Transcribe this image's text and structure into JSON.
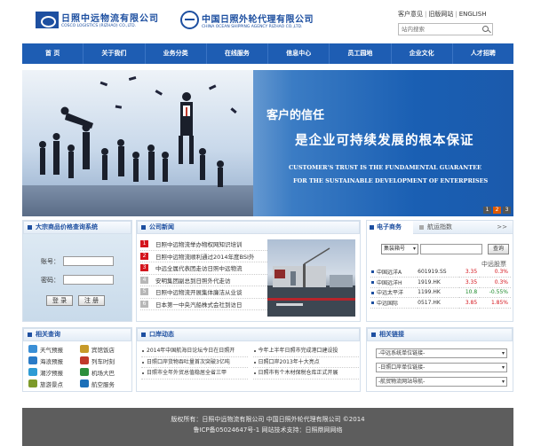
{
  "header": {
    "logo1_cn": "日照中远物流有限公司",
    "logo1_en": "COSCO LOGISTICS (RIZHAO) CO.,LTD.",
    "logo2_cn": "中国日照外轮代理有限公司",
    "logo2_en": "CHINA OCEAN SHIPPING AGENCY RIZHAO CO.,LTD.",
    "links": [
      "客户意见",
      "旧版网站",
      "ENGLISH"
    ],
    "search_placeholder": "站内搜索"
  },
  "nav": [
    "首 页",
    "关于我们",
    "业务分类",
    "在线服务",
    "信息中心",
    "员工园地",
    "企业文化",
    "人才招聘"
  ],
  "banner": {
    "slogan1": "客户的信任",
    "slogan2": "是企业可持续发展的根本保证",
    "slogan3": "CUSTOMER'S TRUST IS THE FUNDAMENTAL GUARANTEE",
    "slogan4": "FOR THE SUSTAINABLE DEVELOPMENT OF ENTERPRISES",
    "dots": [
      "1",
      "2",
      "3"
    ]
  },
  "price": {
    "title": "大宗商品价格查询系统",
    "account_label": "账号：",
    "password_label": "密码：",
    "login": "登 录",
    "register": "注 册"
  },
  "news": {
    "title": "公司新闻",
    "items": [
      {
        "num": "1",
        "text": "日照中远物流举办物权网知识培训"
      },
      {
        "num": "2",
        "text": "日照中远物流顺利通过2014年度BSI外"
      },
      {
        "num": "3",
        "text": "中远全属代表团走访日照中远物流"
      },
      {
        "num": "4",
        "text": "安明集团副总到日照外代走访"
      },
      {
        "num": "5",
        "text": "日照中远物流开展集体廉洁从业谈"
      },
      {
        "num": "6",
        "text": "日本第一中央汽船株式会社到访日"
      }
    ]
  },
  "ecom": {
    "tab1": "电子商务",
    "tab2": "航运指数",
    "more": ">>",
    "select": "集装箱号",
    "query": "查询",
    "label": "中远股票",
    "stocks": [
      {
        "name": "中国远洋A",
        "code": "601919.SS",
        "price": "3.35",
        "change": "0.3%",
        "dir": "up"
      },
      {
        "name": "中国远洋H",
        "code": "1919.HK",
        "price": "3.35",
        "change": "0.3%",
        "dir": "up"
      },
      {
        "name": "中远太平洋",
        "code": "1199.HK",
        "price": "10.8",
        "change": "-0.55%",
        "dir": "dn"
      },
      {
        "name": "中远国际",
        "code": "0517.HK",
        "price": "3.85",
        "change": "1.85%",
        "dir": "up"
      }
    ]
  },
  "qlinks": {
    "title": "相关查询",
    "items": [
      {
        "label": "天气预报",
        "color": "#3a8fd6",
        "icon": "weather-icon"
      },
      {
        "label": "宾馆饭店",
        "color": "#c79a2a",
        "icon": "hotel-icon"
      },
      {
        "label": "海浪预报",
        "color": "#2a7bc7",
        "icon": "wave-icon"
      },
      {
        "label": "列车时刻",
        "color": "#c0392b",
        "icon": "train-icon"
      },
      {
        "label": "潮汐预报",
        "color": "#2e9bd4",
        "icon": "tide-icon"
      },
      {
        "label": "机场大巴",
        "color": "#2d8f3c",
        "icon": "bus-icon"
      },
      {
        "label": "旅游景点",
        "color": "#7d9a2a",
        "icon": "travel-icon"
      },
      {
        "label": "航空服务",
        "color": "#1b6fb8",
        "icon": "plane-icon"
      }
    ]
  },
  "port": {
    "title": "口岸动态",
    "left": [
      "2014年中国航海日论坛今日在日照开",
      "日照口岸货物吞吐量首次突破3亿吨",
      "日照市全年外贸总值稳居全省三甲"
    ],
    "right": [
      "今年上半年日照市完成港口建设投",
      "日照口岸2013年十大亮点",
      "日照市有个木材保税仓库正式开展"
    ]
  },
  "rlinks": {
    "title": "相关链接",
    "options": [
      "-中远系统单位链接-",
      "-日照口岸单位链接-",
      "-航贸物流网站导航-"
    ]
  },
  "footer": {
    "line1": "版权所有：日照中远物流有限公司 中国日照外轮代理有限公司 ©2014",
    "line2": "鲁ICP备05024647号-1 网站技术支持：日照鼎网网络"
  }
}
